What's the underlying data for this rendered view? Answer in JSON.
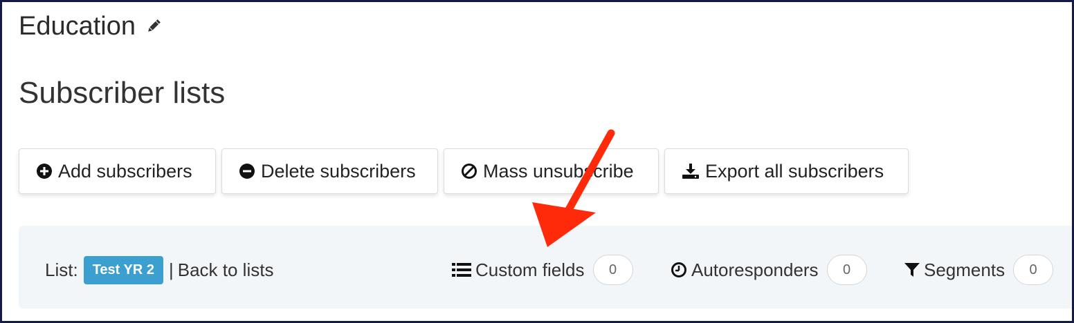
{
  "header": {
    "title": "Education",
    "edit_icon": "pencil-icon"
  },
  "page": {
    "title": "Subscriber lists"
  },
  "actions": {
    "add": {
      "label": "Add subscribers",
      "icon": "plus-circle-icon"
    },
    "delete": {
      "label": "Delete subscribers",
      "icon": "minus-circle-icon"
    },
    "mass_unsubscribe": {
      "label": "Mass unsubscribe",
      "icon": "ban-icon"
    },
    "export": {
      "label": "Export all subscribers",
      "icon": "download-icon"
    }
  },
  "list_bar": {
    "prefix": "List:",
    "list_name": "Test YR 2",
    "separator": "|",
    "back_label": "Back to lists",
    "tabs": [
      {
        "label": "Custom fields",
        "count": "0",
        "icon": "list-icon"
      },
      {
        "label": "Autoresponders",
        "count": "0",
        "icon": "clock-icon"
      },
      {
        "label": "Segments",
        "count": "0",
        "icon": "filter-icon"
      }
    ]
  },
  "colors": {
    "badge": "#3b9fd0",
    "annotation_arrow": "#ff2a0a",
    "frame_border": "#151a4a",
    "list_bar_bg": "#f3f6f9"
  }
}
